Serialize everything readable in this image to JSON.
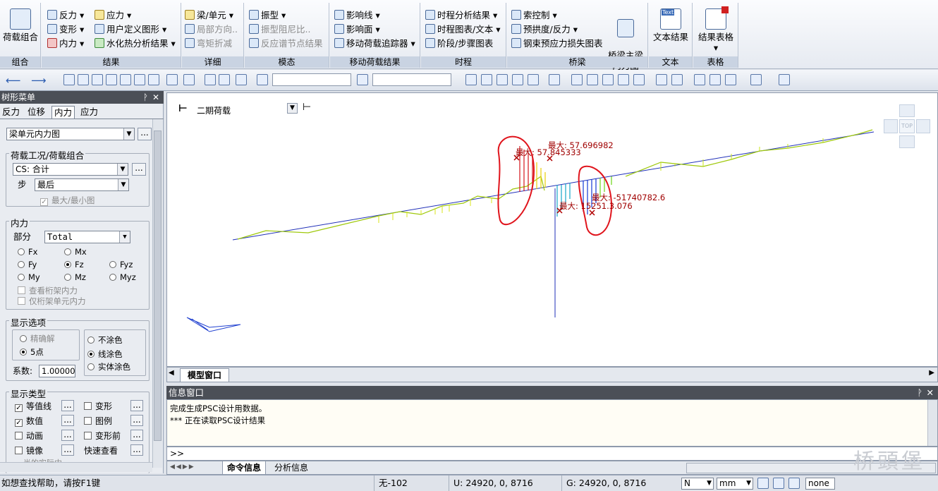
{
  "ribbon": {
    "groups": [
      {
        "label": "组合"
      },
      {
        "label": "结果"
      },
      {
        "label": "详细"
      },
      {
        "label": "模态"
      },
      {
        "label": "移动荷载结果"
      },
      {
        "label": "时程"
      },
      {
        "label": "桥梁"
      },
      {
        "label": "文本"
      },
      {
        "label": "表格"
      }
    ],
    "combo_button": "荷载组合",
    "results_items": [
      "反力",
      "变形",
      "内力",
      "应力",
      "用户定义图形",
      "水化热分析结果"
    ],
    "detail_items": [
      "梁/单元",
      "局部方向..",
      "弯矩折减"
    ],
    "modal_items": [
      "振型",
      "振型阻尼比..",
      "反应谱节点结果"
    ],
    "moving_items": [
      "影响线",
      "影响面",
      "移动荷载追踪器"
    ],
    "history_items": [
      "时程分析结果",
      "时程图表/文本",
      "阶段/步骤图表"
    ],
    "bridge_items": [
      "索控制",
      "预拱度/反力",
      "钢束预应力损失图表"
    ],
    "bridge_big": "桥梁主梁\n内力图",
    "text_big": "文本结果",
    "table_big": "结果表格",
    "text_icon_label": "Text"
  },
  "left": {
    "title": "树形菜单",
    "tabs": [
      "反力",
      "位移",
      "内力",
      "应力"
    ],
    "type_select": "梁单元内力图",
    "load_group_title": "荷载工况/荷载组合",
    "load_case": "CS: 合计",
    "step_label": "步",
    "step_value": "最后",
    "maxmin_label": "最大/最小图",
    "force_title": "内力",
    "part_label": "部分",
    "part_value": "Total",
    "comps": [
      "Fx",
      "Mx",
      "Fy",
      "Fz",
      "Fyz",
      "My",
      "Mz",
      "Myz"
    ],
    "truss_label": "查看桁架内力",
    "truss_only_label": "仅桁架单元内力",
    "display_title": "显示选项",
    "exact_label": "精确解",
    "five_label": "5点",
    "nocolor_label": "不涂色",
    "linecolor_label": "线涂色",
    "solidcolor_label": "实体涂色",
    "coef_label": "系数:",
    "coef_value": "1.000000",
    "disptype_title": "显示类型",
    "disptypes": [
      "等值线",
      "变形",
      "数值",
      "图例",
      "动画",
      "变形前",
      "镜像",
      "快速查看"
    ],
    "more_label": "半的实际内"
  },
  "model": {
    "load_label": "二期荷载",
    "view_top": "TOP",
    "labels": [
      "最大: 57.845333",
      "最大: 57.696982",
      "最大: 15251.3.076",
      "最大: -51740782.6"
    ],
    "tab": "模型窗口"
  },
  "info": {
    "title": "信息窗口",
    "lines": [
      "完成生成PSC设计用数据。",
      "*** 正在读取PSC设计结果"
    ],
    "prompt": ">>",
    "tabs": [
      "命令信息",
      "分析信息"
    ]
  },
  "status": {
    "help": "如想查找帮助，请按F1键",
    "elem": "无-102",
    "u": "U: 24920, 0, 8716",
    "g": "G: 24920, 0, 8716",
    "force_unit": "N",
    "len_unit": "mm",
    "none_sel": "none",
    "watermark": "桥頭堡"
  }
}
